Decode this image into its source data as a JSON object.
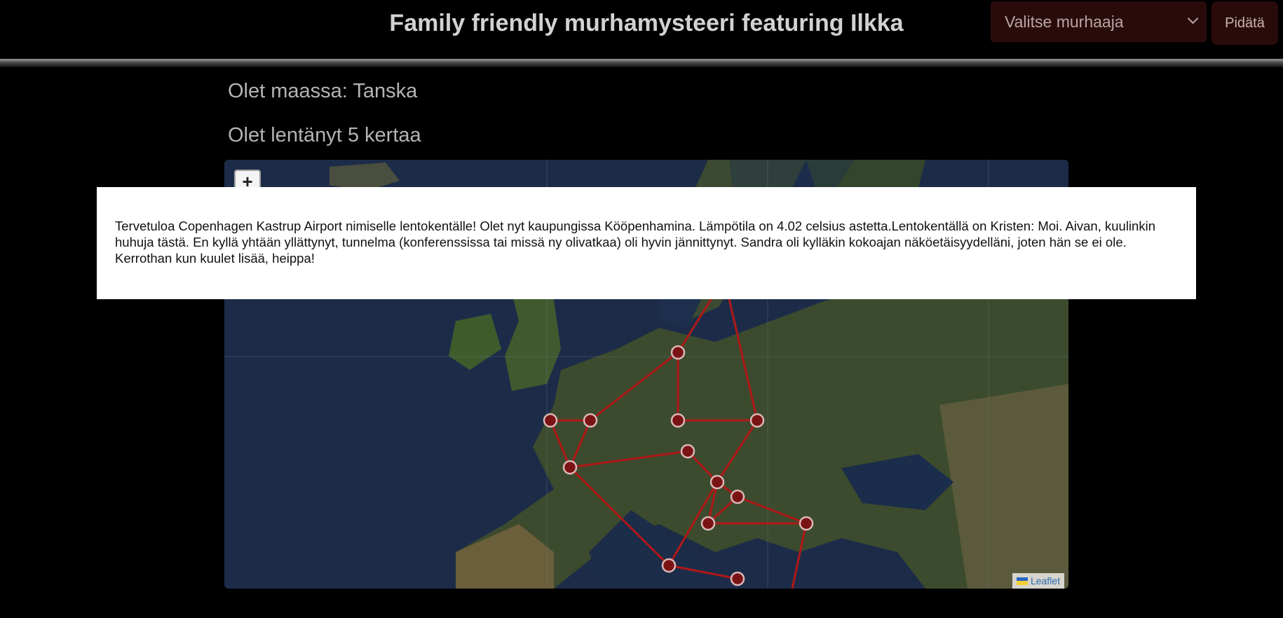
{
  "header": {
    "title": "Family friendly murhamysteeri featuring Ilkka",
    "suspect_select": {
      "selected": "Valitse murhaaja"
    },
    "arrest_button": "Pidätä"
  },
  "status": {
    "country": "Olet maassa: Tanska",
    "flights": "Olet lentänyt 5 kertaa"
  },
  "map": {
    "zoom_in": "+",
    "attribution": "Leaflet",
    "colors": {
      "route": "#b01818",
      "marker_fill": "#7a1414",
      "marker_stroke": "#d9b8b8"
    }
  },
  "dialog": {
    "message": "Tervetuloa Copenhagen Kastrup Airport nimiselle lentokentälle! Olet nyt kaupungissa Kööpenhamina. Lämpötila on 4.02 celsius astetta.Lentokentällä on Kristen: Moi. Aivan, kuulinkin huhuja tästä. En kyllä yhtään yllättynyt, tunnelma (konferenssissa tai missä ny olivatkaa) oli hyvin jännittynyt. Sandra oli kylläkin kokoajan näköetäisyydelläni, joten hän se ei ole. Kerrothan kun kuulet lisää, heippa!"
  }
}
